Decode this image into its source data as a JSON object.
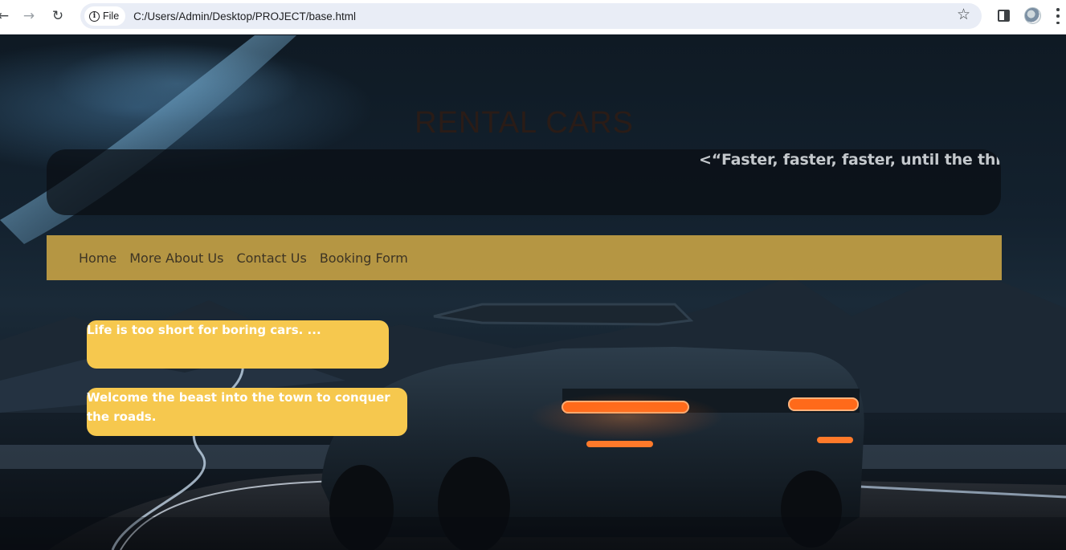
{
  "browser": {
    "back_icon": "arrow-left-icon",
    "forward_icon": "arrow-right-icon",
    "reload_icon": "reload-icon",
    "site_info_label": "File",
    "url": "C:/Users/Admin/Desktop/PROJECT/base.html",
    "bookmark_icon": "star-icon",
    "side_panel_icon": "side-panel-icon",
    "profile_icon": "profile-icon",
    "menu_icon": "more-vertical-icon"
  },
  "page": {
    "title": "RENTAL CARS",
    "marquee": "<“Faster, faster, faster, until the thrill of",
    "nav": {
      "items": [
        {
          "label": "Home"
        },
        {
          "label": "More About Us"
        },
        {
          "label": "Contact Us"
        },
        {
          "label": "Booking Form"
        }
      ]
    },
    "quotes": [
      {
        "text": "Life is too short for boring cars. ..."
      },
      {
        "text": "Welcome the beast into the town to conquer the roads."
      }
    ]
  },
  "colors": {
    "navbar_bg": "#cca646",
    "quote_bg": "#f6c84e",
    "title_text": "#2a1c17",
    "taillight": "#ff6a1a"
  }
}
